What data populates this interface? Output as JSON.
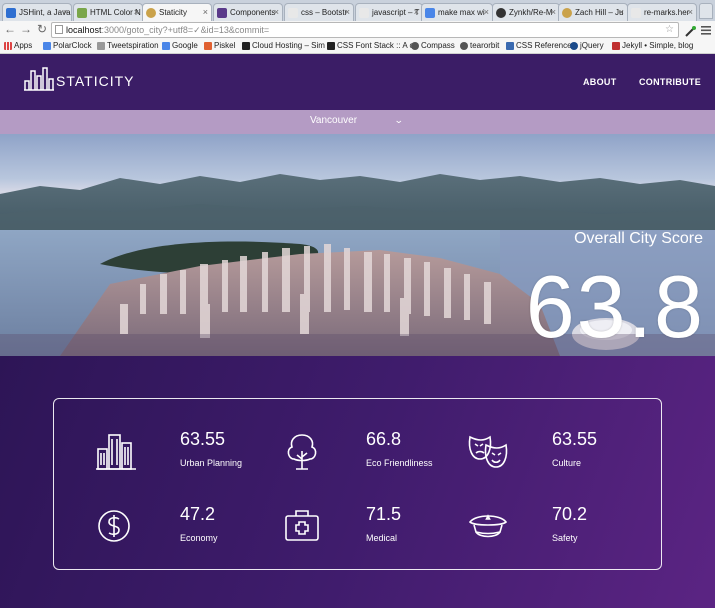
{
  "browser": {
    "tabs": [
      {
        "label": "JSHint, a Java",
        "color": "#2f6fd1"
      },
      {
        "label": "HTML Color N",
        "color": "#7aa64a"
      },
      {
        "label": "Staticity",
        "color": "#caa24a"
      },
      {
        "label": "Components",
        "color": "#5a3a8a"
      },
      {
        "label": "css – Bootstr",
        "color": "#e8e8e8"
      },
      {
        "label": "javascript – T",
        "color": "#e8e8e8"
      },
      {
        "label": "make max wi",
        "color": "#4a86e8"
      },
      {
        "label": "Zynkh/Re-M",
        "color": "#333333"
      },
      {
        "label": "Zach Hill – Ju",
        "color": "#caa24a"
      },
      {
        "label": "re-marks.her",
        "color": "#e8e8e8"
      }
    ],
    "url_host": "localhost",
    "url_path": ":3000/goto_city?+utf8=✓&id=13&commit=",
    "bookmarks": [
      {
        "label": "Apps",
        "color": "#4a86e8"
      },
      {
        "label": "PolarClock",
        "color": "#4a86e8"
      },
      {
        "label": "Tweetspiration",
        "color": "#999999"
      },
      {
        "label": "Google",
        "color": "#4a86e8"
      },
      {
        "label": "Piskel",
        "color": "#e06030"
      },
      {
        "label": "Cloud Hosting – Sim",
        "color": "#222222"
      },
      {
        "label": "CSS Font Stack :: A c",
        "color": "#222222"
      },
      {
        "label": "Compass",
        "color": "#555555"
      },
      {
        "label": "tearorbit",
        "color": "#555555"
      },
      {
        "label": "CSS Reference",
        "color": "#3a6ab0"
      },
      {
        "label": "jQuery",
        "color": "#1a4a8a"
      },
      {
        "label": "Jekyll • Simple, blog",
        "color": "#c03030"
      }
    ]
  },
  "site": {
    "logo": "STATICITY",
    "nav": [
      "ABOUT",
      "CONTRIBUTE"
    ],
    "city": "Vancouver",
    "score_label": "Overall City Score",
    "score": "63.8"
  },
  "metrics": [
    {
      "value": "63.55",
      "label": "Urban Planning",
      "icon": "city-buildings-icon"
    },
    {
      "value": "66.8",
      "label": "Eco Friendliness",
      "icon": "tree-icon"
    },
    {
      "value": "63.55",
      "label": "Culture",
      "icon": "theatre-masks-icon"
    },
    {
      "value": "47.2",
      "label": "Economy",
      "icon": "dollar-coin-icon"
    },
    {
      "value": "71.5",
      "label": "Medical",
      "icon": "medical-kit-icon"
    },
    {
      "value": "70.2",
      "label": "Safety",
      "icon": "police-hat-icon"
    }
  ]
}
